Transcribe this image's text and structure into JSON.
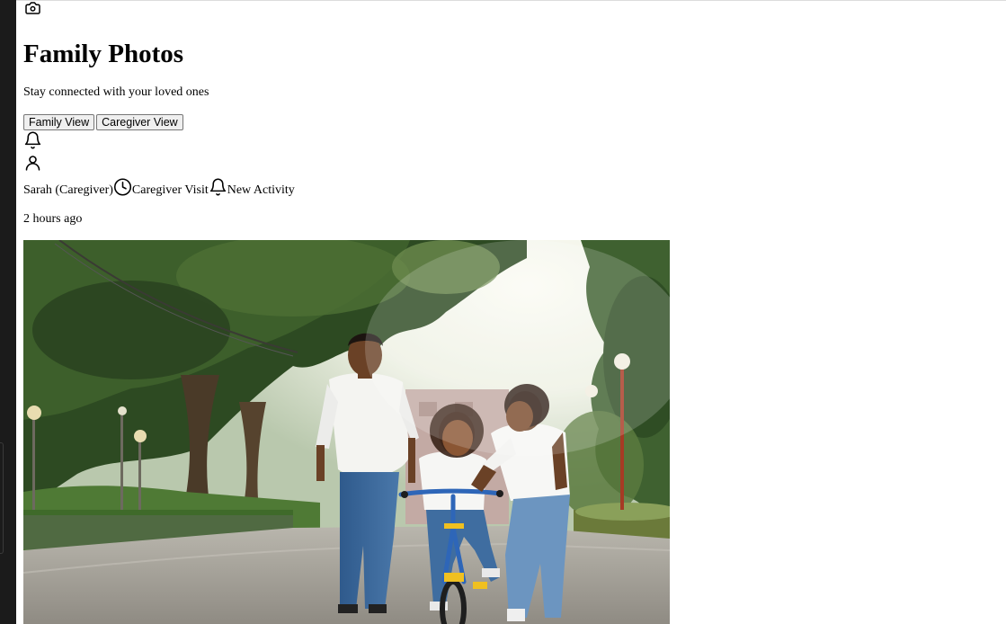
{
  "header": {
    "app_icon": "camera-icon",
    "title": "Family Photos",
    "subtitle": "Stay connected with your loved ones"
  },
  "view_toggle": {
    "family_label": "Family View",
    "caregiver_label": "Caregiver View"
  },
  "toolbar_icons": [
    "bell-icon",
    "user-icon"
  ],
  "activity": {
    "author": "Sarah (Caregiver)",
    "type_icon": "clock-icon",
    "type_label": "Caregiver Visit",
    "status_icon": "bell-icon",
    "status_label": "New Activity",
    "time": "2 hours ago"
  },
  "photo": {
    "subject": "family-with-child-on-bicycle"
  }
}
